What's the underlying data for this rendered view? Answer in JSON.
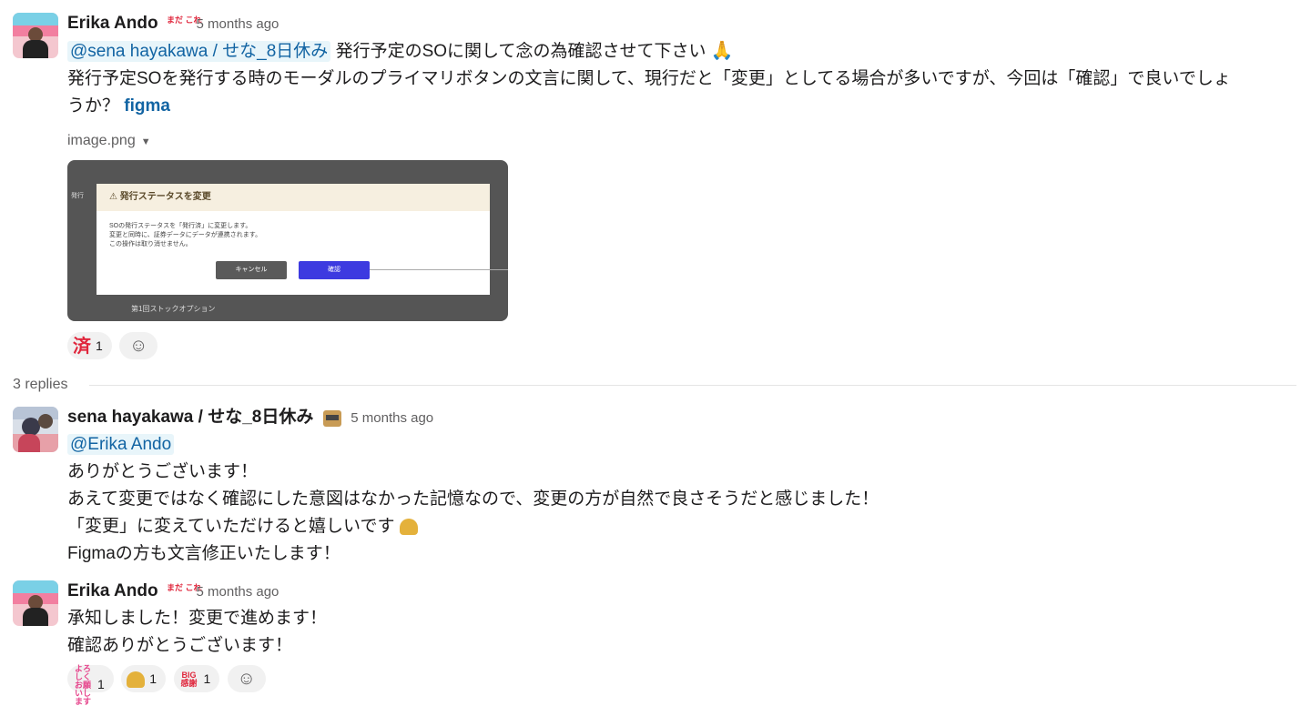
{
  "messages": [
    {
      "author": "Erika Ando",
      "status_badge": "まだ これ",
      "time": "5 months ago",
      "mention": "@sena hayakawa / せな_8日休み",
      "line1_text": "発行予定のSOに関して念の為確認させて下さい",
      "line1_emoji": "🙏",
      "line2_text": "発行予定SOを発行する時のモーダルのプライマリボタンの文言に関して、現行だと「変更」としてる場合が多いですが、今回は「確認」で良いでしょ",
      "line3_text": "うか？",
      "link_text": "figma",
      "file_name": "image.png",
      "file_caret": "▼",
      "preview": {
        "side_label": "発行",
        "modal_title": "発行ステータスを変更",
        "body_lines": [
          "SOの発行ステータスを「発行済」に変更します。",
          "変更と同時に、証券データにデータが連携されます。",
          "この操作は取り消せません。"
        ],
        "cancel_label": "キャンセル",
        "confirm_label": "確認",
        "bottom_label": "第1回ストックオプション"
      },
      "reactions": [
        {
          "emoji": "済",
          "count": "1"
        }
      ],
      "add_reaction_icon": "☺"
    },
    {
      "author": "sena hayakawa / せな_8日休み",
      "time": "5 months ago",
      "mention": "@Erika Ando",
      "lines": [
        "ありがとうございます！",
        "あえて変更ではなく確認にした意図はなかった記憶なので、変更の方が自然で良さそうだと感じました！",
        "「変更」に変えていただけると嬉しいです",
        "Figmaの方も文言修正いたします！"
      ]
    },
    {
      "author": "Erika Ando",
      "status_badge": "まだ これ",
      "time": "5 months ago",
      "lines": [
        "承知しました！変更で進めます！",
        "確認ありがとうございます！"
      ],
      "reactions": [
        {
          "emoji": "よろしく お願いします",
          "count": "1"
        },
        {
          "emoji": "bow",
          "count": "1"
        },
        {
          "emoji": "BIG 感謝",
          "count": "1"
        }
      ],
      "add_reaction_icon": "☺"
    }
  ],
  "replies_label": "3 replies"
}
